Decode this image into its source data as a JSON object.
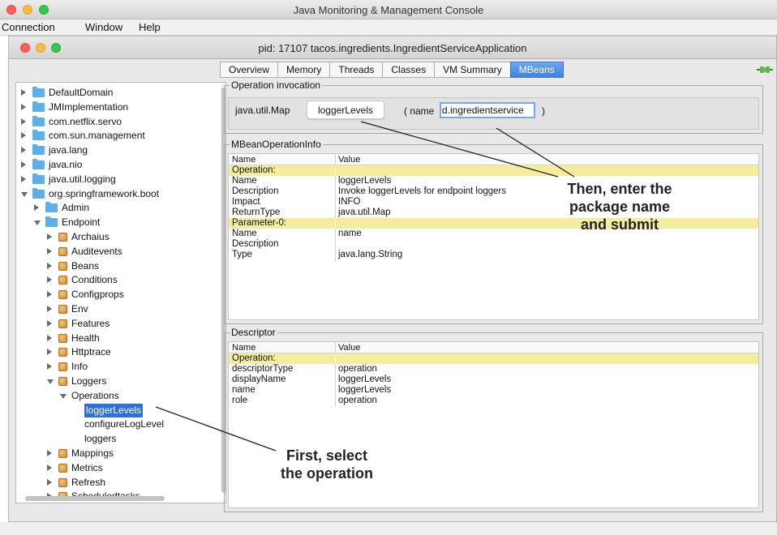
{
  "app": {
    "title": "Java Monitoring & Management Console",
    "menu": [
      "Connection",
      "Window",
      "Help"
    ]
  },
  "window": {
    "title": "pid: 17107 tacos.ingredients.IngredientServiceApplication",
    "tabs": [
      {
        "label": "Overview",
        "active": false
      },
      {
        "label": "Memory",
        "active": false
      },
      {
        "label": "Threads",
        "active": false
      },
      {
        "label": "Classes",
        "active": false
      },
      {
        "label": "VM Summary",
        "active": false
      },
      {
        "label": "MBeans",
        "active": true
      }
    ]
  },
  "tree": {
    "items": [
      {
        "label": "DefaultDomain",
        "icon": "folder-icon",
        "state": "collapsed"
      },
      {
        "label": "JMImplementation",
        "icon": "folder-icon",
        "state": "collapsed"
      },
      {
        "label": "com.netflix.servo",
        "icon": "folder-icon",
        "state": "collapsed"
      },
      {
        "label": "com.sun.management",
        "icon": "folder-icon",
        "state": "collapsed"
      },
      {
        "label": "java.lang",
        "icon": "folder-icon",
        "state": "collapsed"
      },
      {
        "label": "java.nio",
        "icon": "folder-icon",
        "state": "collapsed"
      },
      {
        "label": "java.util.logging",
        "icon": "folder-icon",
        "state": "collapsed"
      },
      {
        "label": "org.springframework.boot",
        "icon": "folder-icon",
        "state": "expanded"
      },
      {
        "label": "Admin",
        "icon": "folder-icon",
        "state": "collapsed"
      },
      {
        "label": "Endpoint",
        "icon": "folder-icon",
        "state": "expanded"
      },
      {
        "label": "Archaius",
        "icon": "bean-icon",
        "state": "collapsed"
      },
      {
        "label": "Auditevents",
        "icon": "bean-icon",
        "state": "collapsed"
      },
      {
        "label": "Beans",
        "icon": "bean-icon",
        "state": "collapsed"
      },
      {
        "label": "Conditions",
        "icon": "bean-icon",
        "state": "collapsed"
      },
      {
        "label": "Configprops",
        "icon": "bean-icon",
        "state": "collapsed"
      },
      {
        "label": "Env",
        "icon": "bean-icon",
        "state": "collapsed"
      },
      {
        "label": "Features",
        "icon": "bean-icon",
        "state": "collapsed"
      },
      {
        "label": "Health",
        "icon": "bean-icon",
        "state": "collapsed"
      },
      {
        "label": "Httptrace",
        "icon": "bean-icon",
        "state": "collapsed"
      },
      {
        "label": "Info",
        "icon": "bean-icon",
        "state": "collapsed"
      },
      {
        "label": "Loggers",
        "icon": "bean-icon",
        "state": "expanded"
      },
      {
        "label": "Operations",
        "icon": "",
        "state": "expanded"
      },
      {
        "label": "loggerLevels",
        "icon": "",
        "state": "leaf",
        "selected": true
      },
      {
        "label": "configureLogLevel",
        "icon": "",
        "state": "leaf"
      },
      {
        "label": "loggers",
        "icon": "",
        "state": "leaf"
      },
      {
        "label": "Mappings",
        "icon": "bean-icon",
        "state": "collapsed"
      },
      {
        "label": "Metrics",
        "icon": "bean-icon",
        "state": "collapsed"
      },
      {
        "label": "Refresh",
        "icon": "bean-icon",
        "state": "collapsed"
      },
      {
        "label": "Scheduledtasks",
        "icon": "bean-icon",
        "state": "collapsed"
      }
    ]
  },
  "operation": {
    "group_title": "Operation invocation",
    "return_type": "java.util.Map",
    "button_label": "loggerLevels",
    "param_open": "( name",
    "param_value": "d.ingredientservice",
    "param_close": ")"
  },
  "info": {
    "group_title": "MBeanOperationInfo",
    "headers": [
      "Name",
      "Value"
    ],
    "rows": [
      {
        "name": "Operation:",
        "value": "",
        "highlight": true
      },
      {
        "name": "Name",
        "value": "loggerLevels",
        "highlight": false
      },
      {
        "name": "Description",
        "value": "Invoke loggerLevels for endpoint loggers",
        "highlight": false
      },
      {
        "name": "Impact",
        "value": "INFO",
        "highlight": false
      },
      {
        "name": "ReturnType",
        "value": "java.util.Map",
        "highlight": false
      },
      {
        "name": "Parameter-0:",
        "value": "",
        "highlight": true
      },
      {
        "name": "Name",
        "value": "name",
        "highlight": false
      },
      {
        "name": "Description",
        "value": "",
        "highlight": false
      },
      {
        "name": "Type",
        "value": "java.lang.String",
        "highlight": false
      }
    ]
  },
  "descriptor": {
    "group_title": "Descriptor",
    "headers": [
      "Name",
      "Value"
    ],
    "rows": [
      {
        "name": "Operation:",
        "value": "",
        "highlight": true
      },
      {
        "name": "descriptorType",
        "value": "operation",
        "highlight": false
      },
      {
        "name": "displayName",
        "value": "loggerLevels",
        "highlight": false
      },
      {
        "name": "name",
        "value": "loggerLevels",
        "highlight": false
      },
      {
        "name": "role",
        "value": "operation",
        "highlight": false
      }
    ]
  },
  "annotations": {
    "top_callout": [
      "Then, enter the",
      "package name",
      "and submit"
    ],
    "bottom_callout": [
      "First, select",
      "the operation"
    ]
  },
  "colors": {
    "active_tab": "#3d80e0",
    "selection": "#2f6fd8",
    "row_highlight": "#f4ed9e",
    "folder": "#5eaeea"
  }
}
